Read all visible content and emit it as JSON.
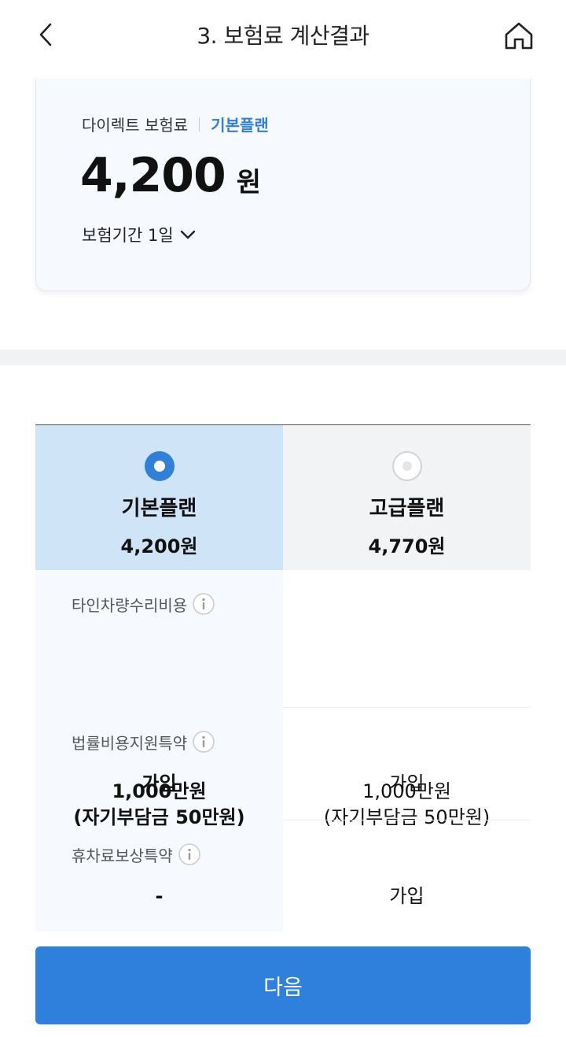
{
  "header": {
    "title": "3. 보험료 계산결과",
    "back_icon": "chevron-left-icon",
    "home_icon": "home-icon"
  },
  "summary": {
    "label": "다이렉트 보험료",
    "plan": "기본플랜",
    "amount": "4,200",
    "unit": "원",
    "period": "보험기간 1일"
  },
  "plans": [
    {
      "name": "기본플랜",
      "price": "4,200원",
      "selected": true
    },
    {
      "name": "고급플랜",
      "price": "4,770원",
      "selected": false
    }
  ],
  "rows": [
    {
      "label": "타인차량수리비용",
      "basic": [
        "1,000만원",
        "(자기부담금 50만원)"
      ],
      "premium": [
        "1,000만원",
        "(자기부담금 50만원)"
      ]
    },
    {
      "label": "법률비용지원특약",
      "basic": [
        "가입"
      ],
      "premium": [
        "가입"
      ]
    },
    {
      "label": "휴차료보상특약",
      "basic": [
        "-"
      ],
      "premium": [
        "가입"
      ]
    }
  ],
  "next_label": "다음",
  "colors": {
    "accent": "#2f80dc",
    "selected_bg": "#d0e4f7",
    "plan_text": "#2f80d6"
  }
}
